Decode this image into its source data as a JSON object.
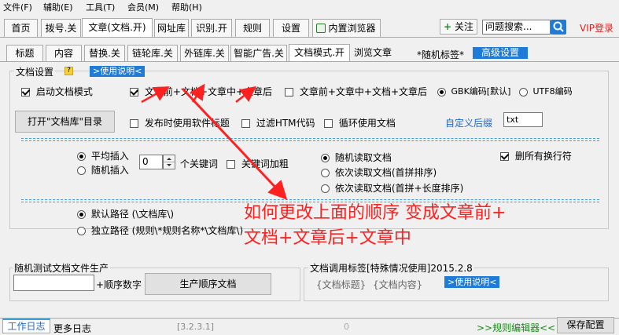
{
  "menubar": [
    "文件(F)",
    "辅助(E)",
    "工具(T)",
    "会员(M)",
    "帮助(H)"
  ],
  "main_tabs": [
    "首页",
    "拨号.关",
    "文章(文档.开)",
    "网址库",
    "识别.开",
    "规则",
    "设置",
    "内置浏览器"
  ],
  "header": {
    "follow_label": "关注",
    "search_placeholder": "问题搜索...",
    "vip_login": "VIP登录"
  },
  "sub_tabs": [
    "标题",
    "内容",
    "替换.关",
    "链轮库.关",
    "外链库.关",
    "智能广告.关",
    "文档模式.开",
    "浏览文章"
  ],
  "random_tag_label": "*随机标签*",
  "advanced_settings": "高级设置",
  "doc_settings": {
    "title": "文档设置",
    "help_icon_text": "?",
    "usage_link": ">使用说明<",
    "enable_doc_mode": "启动文档模式",
    "order_option_1": "文章前+文档+文章中+文章后",
    "order_option_2": "文章前+文章中+文档+文章后",
    "encoding_gbk": "GBK编码[默认]",
    "encoding_utf8": "UTF8编码",
    "open_library_button": "打开\"文档库\"目录",
    "use_software_title": "发布时使用软件标题",
    "filter_htm": "过滤HTM代码",
    "loop_use_doc": "循环使用文档",
    "custom_suffix_label": "自定义后缀",
    "custom_suffix_value": "txt"
  },
  "insert": {
    "average_insert": "平均插入",
    "random_insert": "随机插入",
    "keyword_count": "0",
    "keyword_label": "个关键词",
    "keyword_bold": "关键词加粗"
  },
  "read_mode": {
    "random_read": "随机读取文档",
    "seq_pinyin": "依次读取文档(首拼排序)",
    "seq_pinyin_length": "依次读取文档(首拼+长度排序)",
    "delete_newlines": "删所有换行符"
  },
  "path": {
    "default_path": "默认路径 (\\文档库\\)",
    "independent_path": "独立路径 (规则\\*规则名称*\\文档库\\)"
  },
  "annotation": {
    "text_line1": "如何更改上面的顺序 变成文章前+",
    "text_line2": "文档+文章后+文章中",
    "color": "#ff2020"
  },
  "random_test": {
    "title": "随机测试文档文件生产",
    "order_number_label": "+顺序数字",
    "produce_button": "生产顺序文档"
  },
  "doc_tags": {
    "title": "文档调用标签[特殊情况使用]2015.2.8",
    "tag_title": "{文档标题}",
    "tag_content": "{文档内容}",
    "usage_link": ">使用说明<"
  },
  "status_bar": {
    "work_log": "工作日志",
    "more_log": "更多日志",
    "version": "[3.2.3.1]",
    "counter": "0",
    "rule_editor": ">>规则编辑器<<",
    "save_config": "保存配置"
  },
  "colors": {
    "accent_blue": "#1e7bd8",
    "dash_blue": "#3ea0d8",
    "vip_red": "#e02020",
    "link_green": "#1a8a1a"
  }
}
